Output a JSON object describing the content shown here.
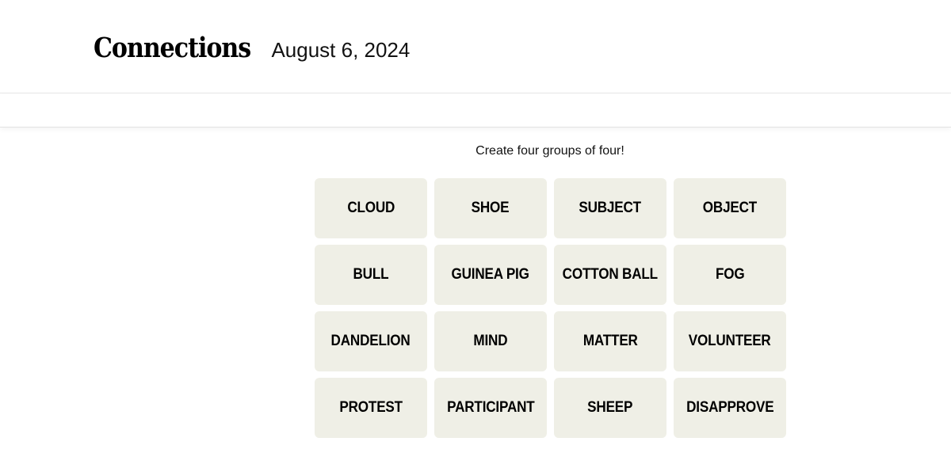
{
  "header": {
    "title": "Connections",
    "date": "August 6, 2024"
  },
  "game": {
    "instructions": "Create four groups of four!",
    "tile_color": "#efefe6",
    "tiles": [
      {
        "label": "CLOUD"
      },
      {
        "label": "SHOE"
      },
      {
        "label": "SUBJECT"
      },
      {
        "label": "OBJECT"
      },
      {
        "label": "BULL"
      },
      {
        "label": "GUINEA PIG"
      },
      {
        "label": "COTTON BALL"
      },
      {
        "label": "FOG"
      },
      {
        "label": "DANDELION"
      },
      {
        "label": "MIND"
      },
      {
        "label": "MATTER"
      },
      {
        "label": "VOLUNTEER"
      },
      {
        "label": "PROTEST"
      },
      {
        "label": "PARTICIPANT"
      },
      {
        "label": "SHEEP"
      },
      {
        "label": "DISAPPROVE"
      }
    ]
  }
}
